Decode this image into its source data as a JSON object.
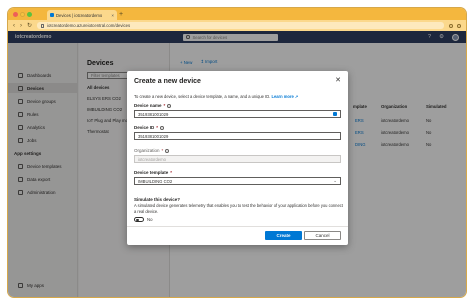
{
  "browser": {
    "tab_title": "Devices | iotcreatordemo",
    "url": "iotcreatordemo.azureiotcentral.com/devices"
  },
  "app": {
    "name": "iotcreatordemo",
    "search_placeholder": "Search for devices"
  },
  "sidebar": {
    "items": [
      {
        "label": "Dashboards",
        "icon": "dashboard-icon"
      },
      {
        "label": "Devices",
        "icon": "devices-icon",
        "active": true
      },
      {
        "label": "Device groups",
        "icon": "device-groups-icon"
      },
      {
        "label": "Rules",
        "icon": "rules-icon"
      },
      {
        "label": "Analytics",
        "icon": "analytics-icon"
      },
      {
        "label": "Jobs",
        "icon": "jobs-icon"
      }
    ],
    "section_label": "App settings",
    "settings_items": [
      {
        "label": "Device templates",
        "icon": "templates-icon"
      },
      {
        "label": "Data export",
        "icon": "export-icon"
      },
      {
        "label": "Administration",
        "icon": "admin-icon"
      }
    ],
    "footer_item": {
      "label": "My apps",
      "icon": "apps-icon"
    }
  },
  "list_panel": {
    "title": "Devices",
    "filter_placeholder": "Filter templates",
    "items": [
      "All devices",
      "ELSYS ERS CO2",
      "IMBUILDING CO2",
      "IoT Plug and Play mobile",
      "Thermostat"
    ]
  },
  "content": {
    "cmd_new": "New",
    "cmd_import": "Import",
    "col_template": "mplate",
    "col_organization": "Organization",
    "col_simulated": "Simulated",
    "rows": [
      {
        "template": "ERS",
        "organization": "iotcreatordemo",
        "simulated": "No"
      },
      {
        "template": "ERS",
        "organization": "iotcreatordemo",
        "simulated": "No"
      },
      {
        "template": "DING",
        "organization": "iotcreatordemo",
        "simulated": "No"
      }
    ]
  },
  "dialog": {
    "title": "Create a new device",
    "description": "To create a new device, select a device template, a name, and a unique ID.",
    "learn_more": "Learn more",
    "device_name_label": "Device name",
    "device_name_value": "3519381001029",
    "device_id_label": "Device ID",
    "device_id_value": "3519381001029",
    "organization_label": "Organization",
    "organization_value": "iotcreatordemo",
    "template_label": "Device template",
    "template_value": "IMBUILDING CO2",
    "simulate_title": "Simulate this device?",
    "simulate_desc": "A simulated device generates telemetry that enables you to test the behavior of your application before you connect a real device.",
    "toggle_label": "No",
    "create_label": "Create",
    "cancel_label": "Cancel"
  }
}
